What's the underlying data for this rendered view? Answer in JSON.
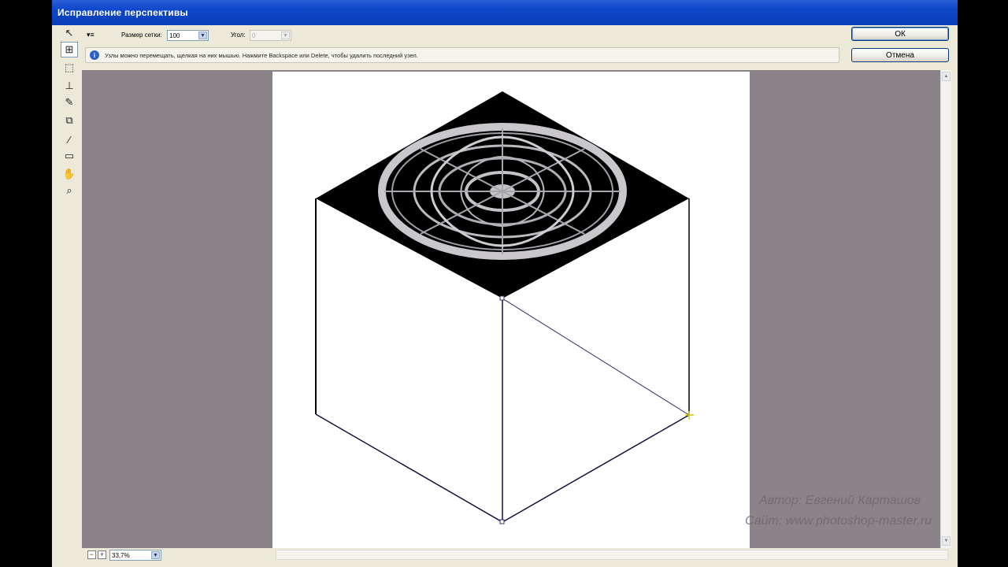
{
  "window": {
    "title": "Исправление перспективы"
  },
  "tools": [
    {
      "name": "edit-plane-tool-icon",
      "glyph": "↖"
    },
    {
      "name": "create-plane-tool-icon",
      "glyph": "⊞",
      "active": true
    },
    {
      "name": "marquee-tool-icon",
      "glyph": "⬚"
    },
    {
      "name": "stamp-tool-icon",
      "glyph": "⊥"
    },
    {
      "name": "brush-tool-icon",
      "glyph": "✎"
    },
    {
      "name": "transform-tool-icon",
      "glyph": "⧉"
    },
    {
      "name": "eyedropper-tool-icon",
      "glyph": "⁄"
    },
    {
      "name": "measure-tool-icon",
      "glyph": "▭"
    },
    {
      "name": "hand-tool-icon",
      "glyph": "✋"
    },
    {
      "name": "zoom-tool-icon",
      "glyph": "⌕"
    }
  ],
  "options": {
    "menu_glyph": "▾≡",
    "grid_label": "Размер сетки:",
    "grid_value": "100",
    "angle_label": "Угол:",
    "angle_value": "0"
  },
  "info": {
    "text": "Узлы можно перемещать, щелкая на них мышью.  Нажмите Backspace или Delete, чтобы удалить последний узел."
  },
  "buttons": {
    "ok": "ОК",
    "cancel": "Отмена"
  },
  "zoom": {
    "value": "33,7%",
    "minus": "−",
    "plus": "+"
  },
  "watermark": {
    "author": "Автор: Евгений Карташов",
    "site": "Сайт: www.photoshop-master.ru"
  }
}
